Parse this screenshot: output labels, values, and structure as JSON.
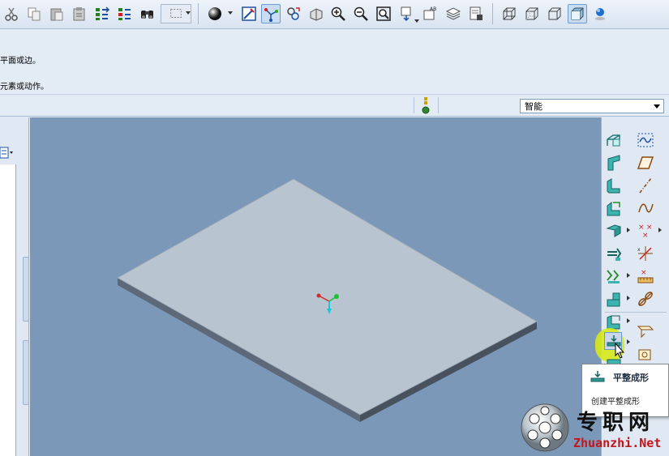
{
  "messages": {
    "line1": "平面或边。",
    "line2": "元素或动作。"
  },
  "filter": {
    "selected": "智能"
  },
  "tooltip": {
    "title": "平整成形",
    "description": "创建平整成形"
  },
  "watermark": {
    "chinese": "专职网",
    "url": "Zhuanzhi.Net"
  },
  "icons": {
    "toolbar": [
      "cut-icon",
      "copy-icon",
      "paste-icon",
      "paste-special-icon",
      "regenerate-icon",
      "regenerate-manager-icon",
      "find-icon",
      "select-box-icon",
      "shading-sphere-icon",
      "repaint-icon",
      "spin-center-icon",
      "named-view-icon",
      "orient-icon",
      "zoom-in-icon",
      "zoom-out-icon",
      "refit-icon",
      "saved-views-icon",
      "annotation-display-icon",
      "layers-icon",
      "model-tree-settings-icon",
      "wireframe-icon",
      "hidden-line-icon",
      "no-hidden-icon",
      "shaded-icon",
      "sphere-display-icon"
    ],
    "right_toolbar": [
      "sheetmetal-wall-icon",
      "sketch-icon",
      "flange-wall-icon",
      "plane-icon",
      "extend-icon",
      "axis-icon",
      "unbend-icon",
      "curve-icon",
      "bend-icon",
      "point-icon",
      "edge-rip-icon",
      "csys-icon",
      "conversion-icon",
      "analysis-icon",
      "corner-relief-icon",
      "datum-chain-icon",
      "bend-back-icon",
      "flatten-icon",
      "form-icon",
      "flat-pattern-icon",
      "punch-icon"
    ]
  },
  "colors": {
    "viewport_bg": "#7b98b9",
    "plate_top": "#b8c4d0",
    "plate_edge": "#5d6978",
    "highlight": "#d7ea1a",
    "watermark_url": "#c0171c"
  }
}
